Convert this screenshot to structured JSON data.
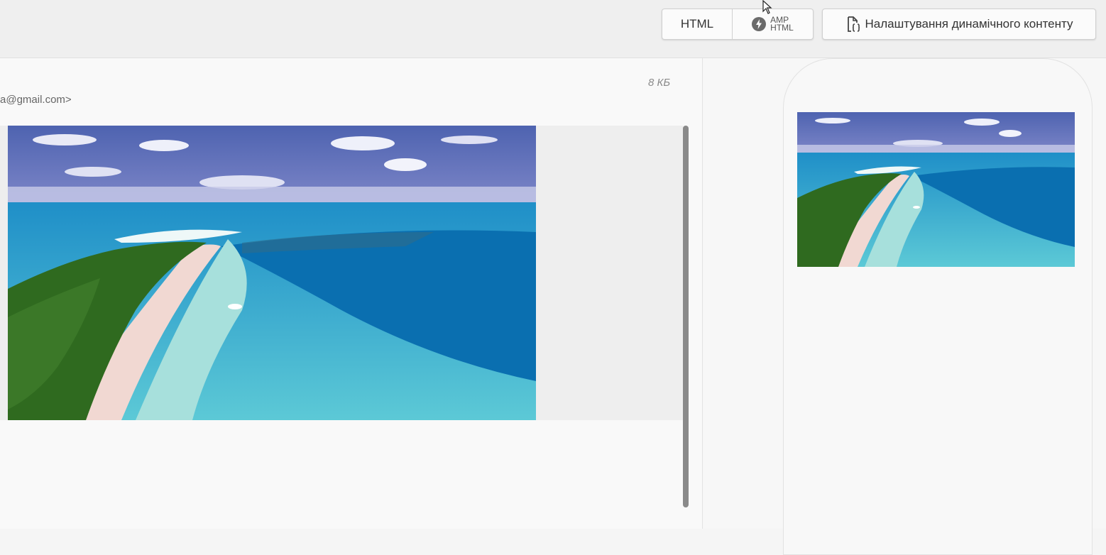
{
  "toolbar": {
    "html_label": "HTML",
    "amp_top": "AMP",
    "amp_bottom": "HTML",
    "dynamic_label": "Налаштування динамічного контенту"
  },
  "email": {
    "size": "8 КБ",
    "from": "a@gmail.com>"
  },
  "icons": {
    "amp": "amp-lightning-icon",
    "dynamic": "dynamic-file-code-icon",
    "cursor": "mouse-cursor-icon"
  },
  "colors": {
    "sky": "#5b6fb6",
    "ocean_deep": "#0a6fb0",
    "lagoon": "#6fd0d6",
    "sand": "#f1d8d2",
    "forest": "#2f6a1f"
  }
}
